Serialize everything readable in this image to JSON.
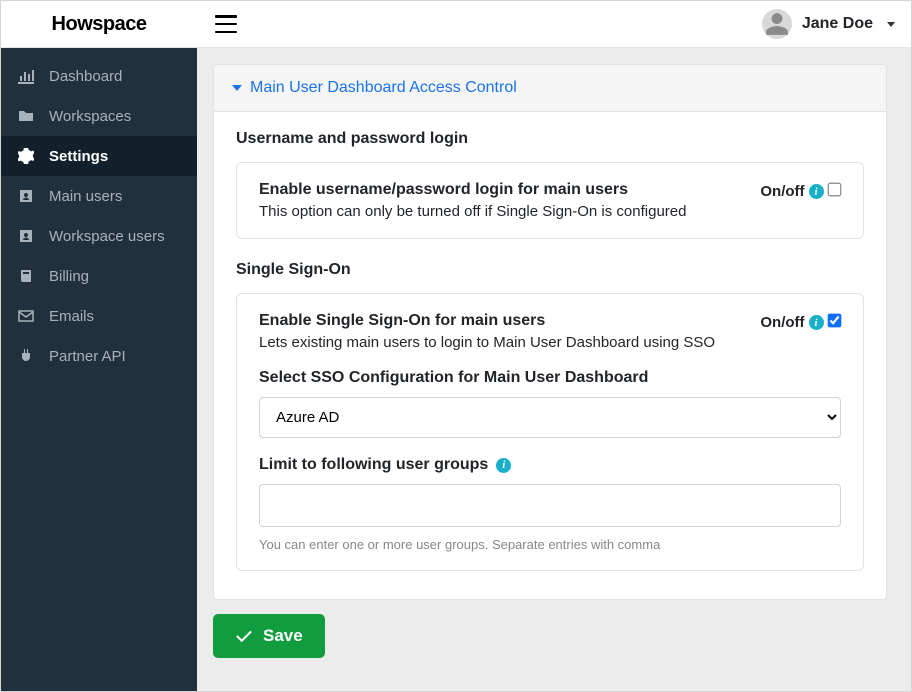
{
  "brand": "Howspace",
  "user": {
    "name": "Jane Doe"
  },
  "sidebar": {
    "items": [
      {
        "label": "Dashboard"
      },
      {
        "label": "Workspaces"
      },
      {
        "label": "Settings",
        "active": true
      },
      {
        "label": "Main users"
      },
      {
        "label": "Workspace users"
      },
      {
        "label": "Billing"
      },
      {
        "label": "Emails"
      },
      {
        "label": "Partner API"
      }
    ]
  },
  "panel": {
    "title": "Main User Dashboard Access Control"
  },
  "userpass": {
    "section_title": "Username and password login",
    "row_title": "Enable username/password login for main users",
    "row_sub": "This option can only be turned off if Single Sign-On is configured",
    "onoff_label": "On/off",
    "checked": false
  },
  "sso": {
    "section_title": "Single Sign-On",
    "row_title": "Enable Single Sign-On for main users",
    "row_sub": "Lets existing main users to login to Main User Dashboard using SSO",
    "onoff_label": "On/off",
    "checked": true,
    "config_label": "Select SSO Configuration for Main User Dashboard",
    "config_selected": "Azure AD",
    "groups_label": "Limit to following user groups",
    "groups_value": "",
    "groups_hint": "You can enter one or more user groups. Separate entries with comma"
  },
  "buttons": {
    "save": "Save"
  }
}
